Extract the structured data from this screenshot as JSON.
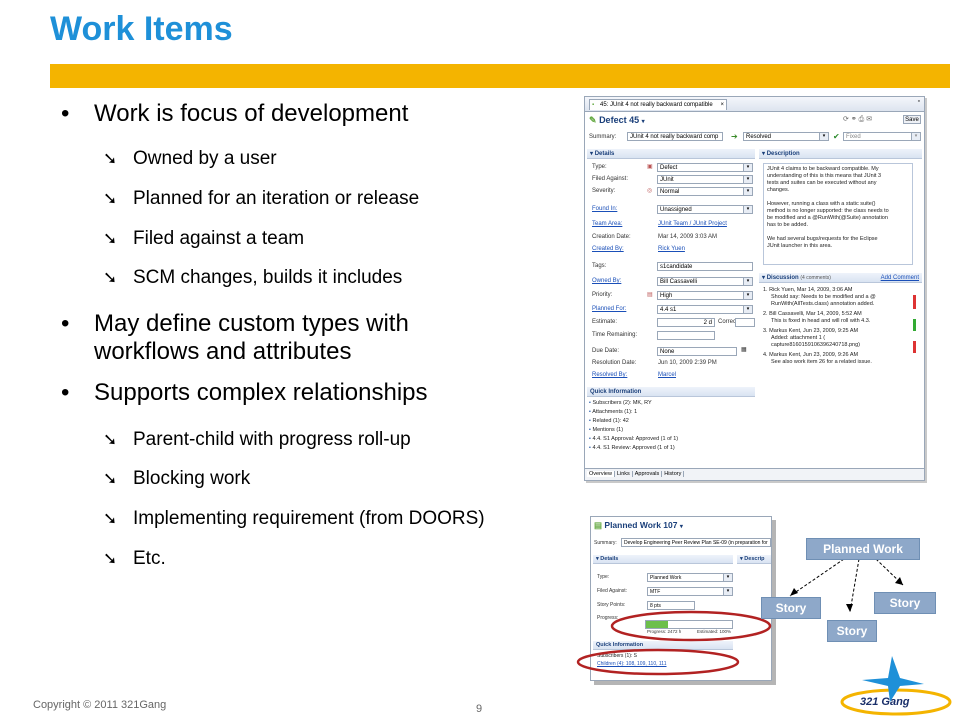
{
  "slide": {
    "title": "Work Items",
    "bullets": [
      {
        "text": "Work is focus of development"
      },
      {
        "text": "May define custom types with",
        "text2": "workflows and attributes"
      },
      {
        "text": "Supports complex relationships"
      }
    ],
    "sub_bullets_1": [
      "Owned by a user",
      "Planned for an iteration or release",
      "Filed against a team",
      "SCM changes, builds it includes"
    ],
    "sub_bullets_3": [
      "Parent-child with progress roll-up",
      "Blocking work",
      "Implementing requirement (from DOORS)",
      "Etc."
    ],
    "copyright": "Copyright © 2011 321Gang",
    "page_number": "9",
    "logo_text": "321 Gang",
    "colors": {
      "title": "#1E90D8",
      "accent_bar": "#F4B400",
      "oval": "#B22222"
    }
  },
  "defect": {
    "tab_label": "45: JUnit 4 not really backward compatible",
    "header": "Defect 45",
    "summary_label": "Summary:",
    "summary_value": "JUnit 4 not really backward comp",
    "status": "Resolved",
    "resolution": "Fixed",
    "save": "Save",
    "details_head": "Details",
    "description_head": "Description",
    "fields": [
      {
        "label": "Type:",
        "value": "Defect"
      },
      {
        "label": "Filed Against:",
        "value": "JUnit"
      },
      {
        "label": "Severity:",
        "value": "Normal"
      },
      {
        "label": "Found In:",
        "value": "Unassigned"
      },
      {
        "label": "Team Area:",
        "value": "JUnit Team / JUnit Project"
      },
      {
        "label": "Creation Date:",
        "value": "Mar 14, 2009 3:03 AM"
      },
      {
        "label": "Created By:",
        "value": "Rick Yuen"
      },
      {
        "label": "Tags:",
        "value": "s1candidate"
      },
      {
        "label": "Owned By:",
        "value": "Bill Cassavelli"
      },
      {
        "label": "Priority:",
        "value": "High"
      },
      {
        "label": "Planned For:",
        "value": "4.4 s1"
      },
      {
        "label": "Estimate:",
        "value": "2 d"
      },
      {
        "label": "Time Remaining:",
        "value": ""
      },
      {
        "label": "Due Date:",
        "value": "None"
      },
      {
        "label": "Resolution Date:",
        "value": "Jun 10, 2009 2:39 PM"
      },
      {
        "label": "Resolved By:",
        "value": "Marcel"
      }
    ],
    "correction_label": "Correction:",
    "description_text": [
      "JUnit 4 claims to be backward compatible. My",
      "understanding of this is this means that JUnit 3",
      "tests and suites can be executed without any",
      "changes.",
      "",
      "However, running a class with a static suite()",
      "method is no longer supported: the class needs to",
      "be modified and a @RunWith(@Suite) annotation",
      "has to be added.",
      "",
      "We had several bugs/requests for the Eclipse",
      "JUnit launcher in this area."
    ],
    "discussion_head": "Discussion",
    "discussion_count": "(4 comments)",
    "add_comment": "Add Comment",
    "comments": [
      "1. Rick Yuen, Mar 14, 2009, 3:06 AM",
      "Should say: Needs to be modified and a @",
      "RunWith(AllTests.class) annotation added.",
      "2. Bill Cassavelli, Mar 14, 2009, 5:52 AM",
      "This is fixed in head and will roll with 4.3.",
      "3. Markus Kent, Jun 23, 2009, 9:25 AM",
      "Added: attachment 1 (",
      "capture8160159106396240718.png)",
      "4. Markus Kent, Jun 23, 2009, 9:26 AM",
      "See also work item 26 for a related issue."
    ],
    "quick_info_head": "Quick Information",
    "quick_info": [
      "Subscribers (2): MK, RY",
      "Attachments (1): 1",
      "Related (1): 42",
      "Mentions (1)",
      "4.4. S1 Approval: Approved (1 of 1)",
      "4.4. S1 Review: Approved (1 of 1)"
    ],
    "bottom_tabs": [
      "Overview",
      "Links",
      "Approvals",
      "History"
    ]
  },
  "planned": {
    "header": "Planned Work 107",
    "summary_label": "Summary:",
    "summary_value": "Develop Engineering Peer Review Plan SE-09 (in preparation for",
    "details_head": "Details",
    "description_head": "Descrip",
    "fields": [
      {
        "label": "Type:",
        "value": "Planned Work"
      },
      {
        "label": "Filed Against:",
        "value": "MTF"
      },
      {
        "label": "Story Points:",
        "value": "8 pts"
      },
      {
        "label": "Progress:",
        "value": ""
      }
    ],
    "progress_text": "Progress: 2472 h",
    "estimated_text": "Estimated: 100%",
    "progress_fraction": 0.25,
    "quick_info_head": "Quick Information",
    "quick_info": [
      "Subscribers (1): S",
      "Children (4): 108, 109, 110, 111"
    ]
  },
  "diagram": {
    "root": "Planned Work",
    "children": [
      "Story",
      "Story",
      "Story"
    ]
  }
}
